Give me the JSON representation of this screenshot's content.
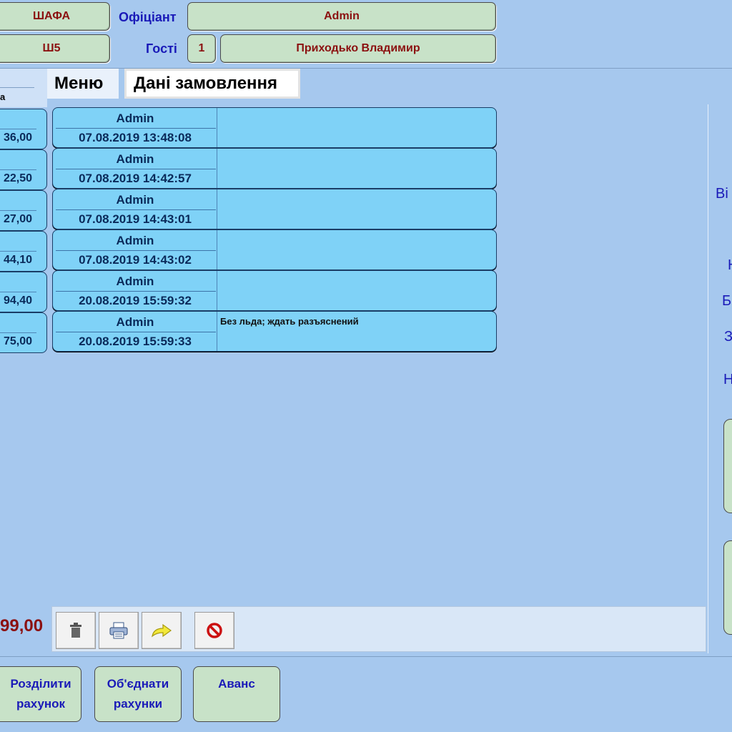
{
  "header": {
    "hall_value": "ШАФА",
    "table_value": "Ш5",
    "waiter_label": "Офіціант",
    "waiter_value": "Admin",
    "guests_label": "Гості",
    "guests_count": "1",
    "client_value": "Приходько Владимир"
  },
  "tabs": {
    "menu": "Меню",
    "order_data": "Дані замовлення"
  },
  "left_column": {
    "header": "а",
    "prices": [
      "36,00",
      "22,50",
      "27,00",
      "44,10",
      "94,40",
      "75,00"
    ]
  },
  "orders": [
    {
      "user": "Admin",
      "datetime": "07.08.2019 13:48:08",
      "note": ""
    },
    {
      "user": "Admin",
      "datetime": "07.08.2019 14:42:57",
      "note": ""
    },
    {
      "user": "Admin",
      "datetime": "07.08.2019 14:43:01",
      "note": ""
    },
    {
      "user": "Admin",
      "datetime": "07.08.2019 14:43:02",
      "note": ""
    },
    {
      "user": "Admin",
      "datetime": "20.08.2019 15:59:32",
      "note": ""
    },
    {
      "user": "Admin",
      "datetime": "20.08.2019 15:59:33",
      "note": "Без льда; ждать разъяснений"
    }
  ],
  "footer": {
    "total": "99,00",
    "tools": [
      "trash-icon",
      "printer-icon",
      "redo-arrow-icon",
      "cancel-icon"
    ]
  },
  "right_panel": {
    "labels": [
      "Ві",
      "Н",
      "Б",
      "З",
      "Н"
    ]
  },
  "bottom_buttons": {
    "split_line1": "Розділити",
    "split_line2": "рахунок",
    "merge_line1": "Об'єднати",
    "merge_line2": "рахунки",
    "advance": "Аванс"
  }
}
